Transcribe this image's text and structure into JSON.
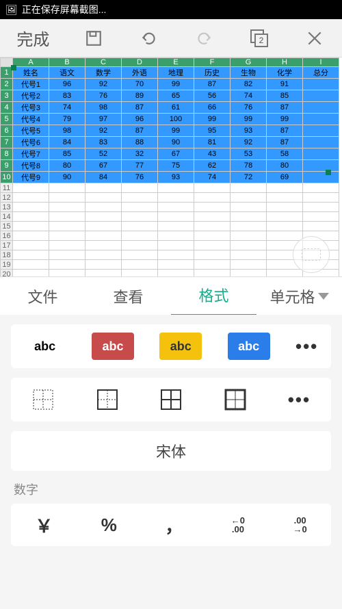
{
  "statusbar": {
    "text": "正在保存屏幕截图..."
  },
  "toolbar": {
    "done": "完成",
    "stack_count": "2"
  },
  "sheet": {
    "cols": [
      "A",
      "B",
      "C",
      "D",
      "E",
      "F",
      "G",
      "H",
      "I"
    ],
    "rows_shown": 22,
    "selected_rows": 10,
    "header": [
      "姓名",
      "语文",
      "数学",
      "外语",
      "地理",
      "历史",
      "生物",
      "化学",
      "总分"
    ],
    "data": [
      [
        "代号1",
        "96",
        "92",
        "70",
        "99",
        "87",
        "82",
        "91",
        ""
      ],
      [
        "代号2",
        "83",
        "76",
        "89",
        "65",
        "56",
        "74",
        "85",
        ""
      ],
      [
        "代号3",
        "74",
        "98",
        "87",
        "61",
        "66",
        "76",
        "87",
        ""
      ],
      [
        "代号4",
        "79",
        "97",
        "96",
        "100",
        "99",
        "99",
        "99",
        ""
      ],
      [
        "代号5",
        "98",
        "92",
        "87",
        "99",
        "95",
        "93",
        "87",
        ""
      ],
      [
        "代号6",
        "84",
        "83",
        "88",
        "90",
        "81",
        "92",
        "87",
        ""
      ],
      [
        "代号7",
        "85",
        "52",
        "32",
        "67",
        "43",
        "53",
        "58",
        ""
      ],
      [
        "代号8",
        "80",
        "67",
        "77",
        "75",
        "62",
        "78",
        "80",
        ""
      ],
      [
        "代号9",
        "90",
        "84",
        "76",
        "93",
        "74",
        "72",
        "69",
        ""
      ]
    ]
  },
  "tabs": {
    "file": "文件",
    "view": "查看",
    "format": "格式",
    "cell": "单元格"
  },
  "panel": {
    "abc": "abc",
    "font": "宋体",
    "number_label": "数字",
    "num_buttons": {
      "currency": "￥",
      "percent": "%",
      "thousand": "，"
    },
    "dec_inc": {
      "top": "←0",
      "bottom": ".00"
    },
    "dec_dec": {
      "top": ".00",
      "bottom": "→0"
    }
  }
}
